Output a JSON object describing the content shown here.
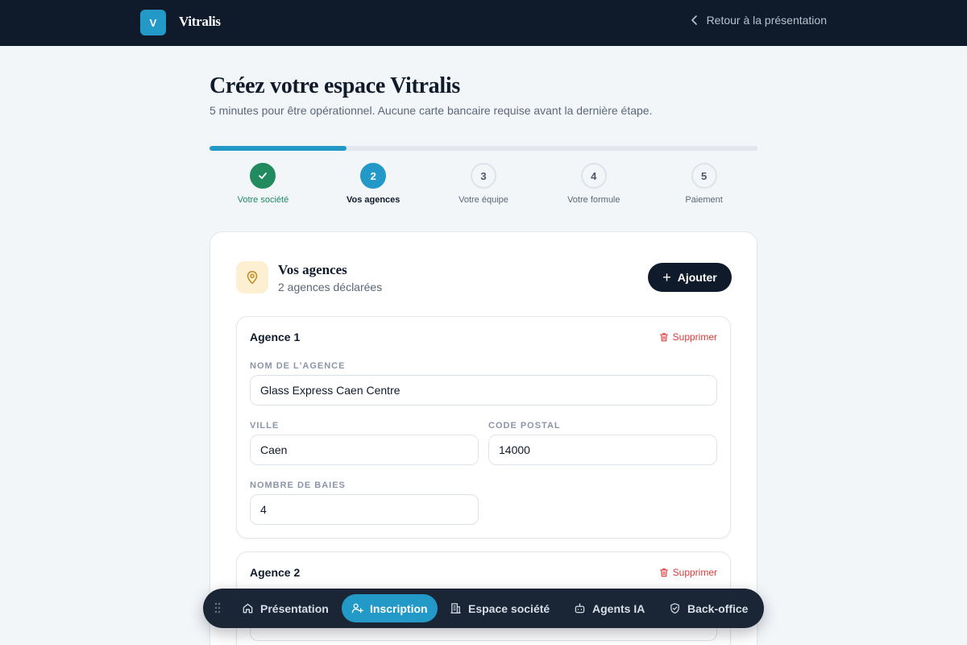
{
  "header": {
    "logo_letter": "V",
    "brand": "Vitralis",
    "back_label": "Retour à la présentation"
  },
  "page": {
    "title": "Créez votre espace Vitralis",
    "subtitle": "5 minutes pour être opérationnel. Aucune carte bancaire requise avant la dernière étape."
  },
  "progress": {
    "fraction": 0.25
  },
  "steps": [
    {
      "number": "1",
      "label": "Votre société",
      "state": "done"
    },
    {
      "number": "2",
      "label": "Vos agences",
      "state": "active"
    },
    {
      "number": "3",
      "label": "Votre équipe",
      "state": "pending"
    },
    {
      "number": "4",
      "label": "Votre formule",
      "state": "pending"
    },
    {
      "number": "5",
      "label": "Paiement",
      "state": "pending"
    }
  ],
  "card": {
    "title": "Vos agences",
    "subtitle": "2 agences déclarées",
    "add_label": "Ajouter"
  },
  "agencies": [
    {
      "title": "Agence 1",
      "delete_label": "Supprimer",
      "name_label": "Nom de l'agence",
      "name_value": "Glass Express Caen Centre",
      "city_label": "Ville",
      "city_value": "Caen",
      "postal_label": "Code postal",
      "postal_value": "14000",
      "bays_label": "Nombre de baies",
      "bays_value": "4"
    },
    {
      "title": "Agence 2",
      "delete_label": "Supprimer"
    }
  ],
  "dock": {
    "items": [
      {
        "label": "Présentation",
        "icon": "home-icon"
      },
      {
        "label": "Inscription",
        "icon": "user-plus-icon"
      },
      {
        "label": "Espace société",
        "icon": "building-icon"
      },
      {
        "label": "Agents IA",
        "icon": "bot-icon"
      },
      {
        "label": "Back-office",
        "icon": "shield-icon"
      }
    ]
  },
  "colors": {
    "navy": "#0f1b2a",
    "accent": "#2399c8",
    "success": "#218a5f",
    "danger": "#d93a3a",
    "pin_bg": "#fcefd2",
    "pin": "#c08a1e"
  }
}
